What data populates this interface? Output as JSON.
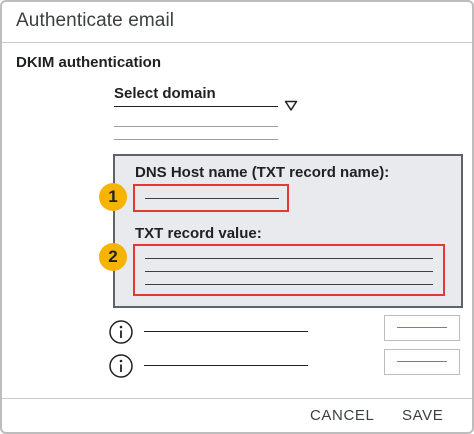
{
  "dialog": {
    "title": "Authenticate email",
    "section_label": "DKIM authentication"
  },
  "domain_select": {
    "label": "Select domain",
    "icon": "caret-down-icon"
  },
  "dns_panel": {
    "host_label": "DNS Host name (TXT record name):",
    "value_label": "TXT record value:",
    "callouts": [
      "1",
      "2"
    ],
    "highlight_color": "#e53935",
    "callout_color": "#f6b400"
  },
  "info_rows": [
    {
      "icon": "info-icon"
    },
    {
      "icon": "info-icon"
    }
  ],
  "footer": {
    "cancel_label": "CANCEL",
    "save_label": "SAVE"
  }
}
